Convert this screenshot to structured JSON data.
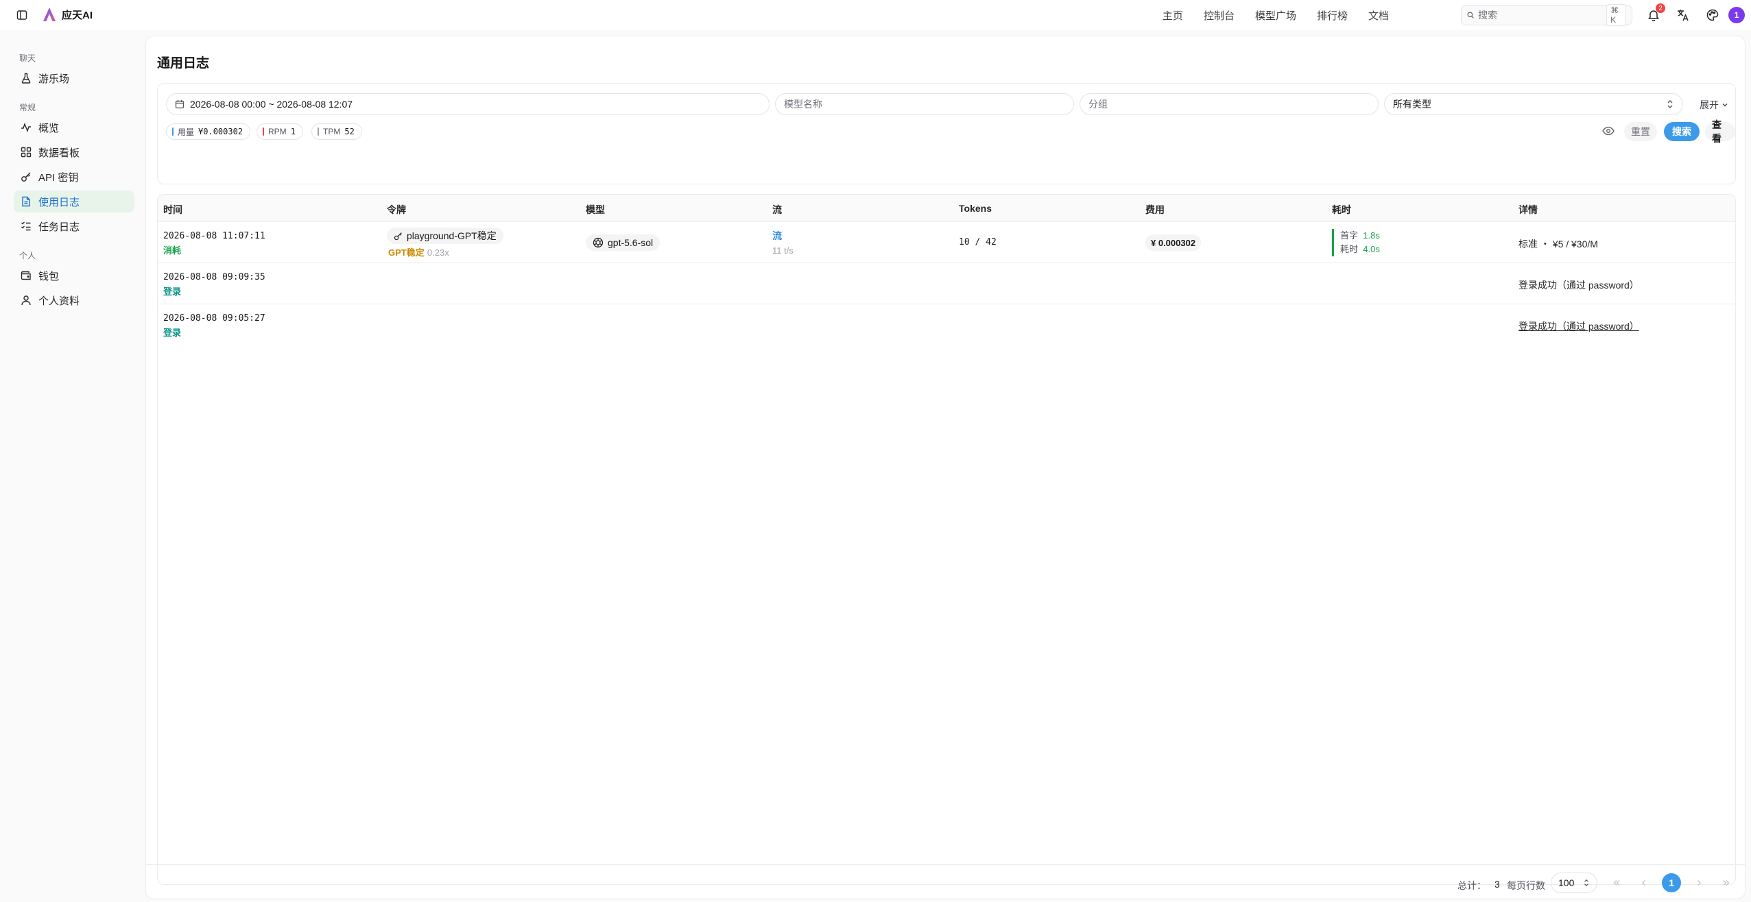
{
  "app": {
    "name": "应天AI"
  },
  "topnav": [
    "主页",
    "控制台",
    "模型广场",
    "排行榜",
    "文档"
  ],
  "search": {
    "placeholder": "搜索",
    "shortcut": "⌘ K"
  },
  "notifications": {
    "count": "2"
  },
  "user": {
    "avatar_text": "1"
  },
  "sidebar": {
    "groups": [
      {
        "label": "聊天",
        "items": [
          {
            "label": "游乐场",
            "icon": "flask-icon"
          }
        ]
      },
      {
        "label": "常规",
        "items": [
          {
            "label": "概览",
            "icon": "activity-icon"
          },
          {
            "label": "数据看板",
            "icon": "dashboard-icon"
          },
          {
            "label": "API 密钥",
            "icon": "key-icon"
          },
          {
            "label": "使用日志",
            "icon": "file-text-icon",
            "active": true
          },
          {
            "label": "任务日志",
            "icon": "list-checks-icon"
          }
        ]
      },
      {
        "label": "个人",
        "items": [
          {
            "label": "钱包",
            "icon": "wallet-icon"
          },
          {
            "label": "个人资料",
            "icon": "user-icon"
          }
        ]
      }
    ]
  },
  "page": {
    "title": "通用日志"
  },
  "filters": {
    "date_range": "2026-08-08 00:00 ~ 2026-08-08 12:07",
    "model_placeholder": "模型名称",
    "group_placeholder": "分组",
    "type_value": "所有类型",
    "expand_label": "展开"
  },
  "stats": [
    {
      "label": "用量",
      "value": "¥0.000302",
      "color": "#3b9ae9"
    },
    {
      "label": "RPM",
      "value": "1",
      "color": "#ef4444"
    },
    {
      "label": "TPM",
      "value": "52",
      "color": "#a1a1aa"
    }
  ],
  "actions": {
    "reset": "重置",
    "search": "搜索",
    "view": "查看"
  },
  "table": {
    "columns": [
      "时间",
      "令牌",
      "模型",
      "流",
      "Tokens",
      "费用",
      "耗时",
      "详情"
    ],
    "rows": [
      {
        "time": "2026-08-08 11:07:11",
        "type": "消耗",
        "token_name": "playground-GPT稳定",
        "group": "GPT稳定",
        "ratio": "0.23x",
        "model": "gpt-5.6-sol",
        "stream": "流",
        "speed": "11 t/s",
        "tokens": "10 / 42",
        "cost": "¥ 0.000302",
        "first_label": "首字",
        "first_value": "1.8s",
        "total_label": "耗时",
        "total_value": "4.0s",
        "detail": "标准 ・ ¥5 / ¥30/M"
      },
      {
        "time": "2026-08-08 09:09:35",
        "type": "登录",
        "detail": "登录成功（通过 password）"
      },
      {
        "time": "2026-08-08 09:05:27",
        "type": "登录",
        "detail": "登录成功（通过 password）"
      }
    ]
  },
  "pagination": {
    "total_label": "总计：",
    "total": "3",
    "per_page_label": "每页行数",
    "per_page": "100",
    "current_page": "1"
  }
}
